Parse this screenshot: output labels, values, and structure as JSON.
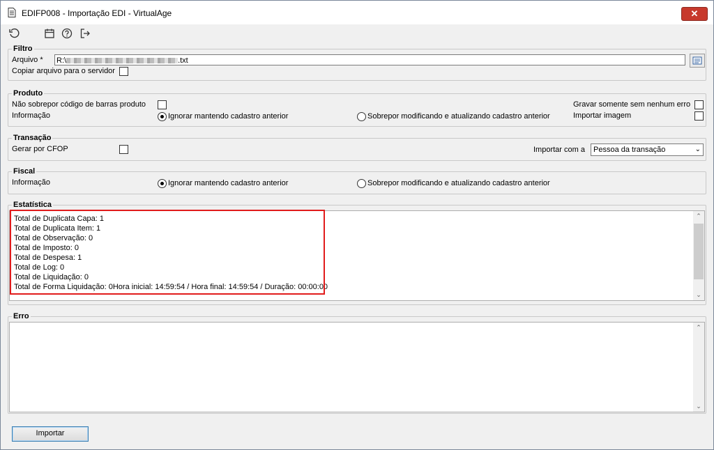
{
  "window": {
    "title": "EDIFP008 - Importação EDI - VirtualAge",
    "close_glyph": "✕"
  },
  "toolbar": {
    "icons": [
      "refresh-icon",
      "calendar-icon",
      "help-icon",
      "exit-icon"
    ]
  },
  "filtro": {
    "legend": "Filtro",
    "arquivo_label": "Arquivo *",
    "arquivo_value_prefix": "R:\\",
    "arquivo_value_suffix": ".txt",
    "copiar_label": "Copiar arquivo para o servidor",
    "copiar_checked": false
  },
  "produto": {
    "legend": "Produto",
    "nao_sobrepor_label": "Não sobrepor código de barras produto",
    "informacao_label": "Informação",
    "opt_ignorar": "Ignorar mantendo cadastro anterior",
    "opt_sobrepor": "Sobrepor modificando e atualizando cadastro anterior",
    "selected": "ignorar",
    "gravar_label": "Gravar somente sem nenhum erro",
    "importar_imagem_label": "Importar imagem"
  },
  "transacao": {
    "legend": "Transação",
    "gerar_cfop_label": "Gerar por CFOP",
    "importar_com_label": "Importar com a",
    "importar_com_value": "Pessoa da transação"
  },
  "fiscal": {
    "legend": "Fiscal",
    "informacao_label": "Informação",
    "opt_ignorar": "Ignorar mantendo cadastro anterior",
    "opt_sobrepor": "Sobrepor modificando e atualizando cadastro anterior",
    "selected": "ignorar"
  },
  "estatistica": {
    "legend": "Estatística",
    "lines": [
      "Total de Duplicata Capa: 1",
      "Total de Duplicata Item: 1",
      "Total de Observação: 0",
      "Total de Imposto: 0",
      "Total de Despesa: 1",
      "Total de Log: 0",
      "Total de Liquidação: 0",
      "Total de Forma Liquidação: 0Hora inicial: 14:59:54 / Hora final: 14:59:54 / Duração: 00:00:00"
    ],
    "highlight_color": "#e11b1b"
  },
  "erro": {
    "legend": "Erro"
  },
  "footer": {
    "importar_label": "Importar"
  }
}
